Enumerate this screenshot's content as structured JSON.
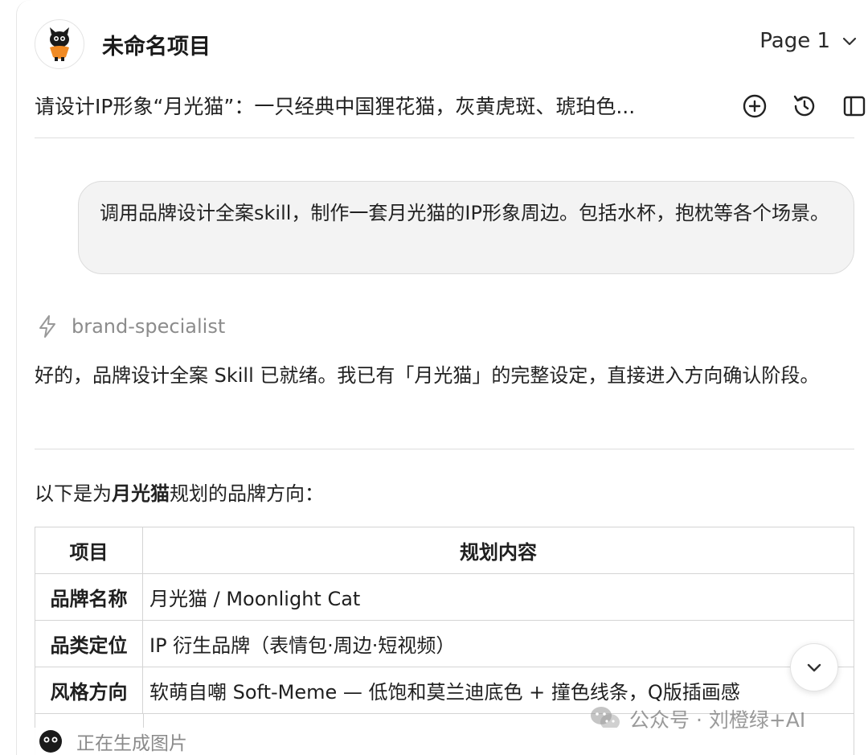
{
  "header": {
    "project_title": "未命名项目",
    "page_label": "Page 1",
    "prompt_preview": "请设计IP形象“月光猫”：一只经典中国狸花猫，灰黄虎斑、琥珀色..."
  },
  "toolbar_icons": [
    "plus-circle-icon",
    "history-icon",
    "sidebar-toggle-icon"
  ],
  "user_message": "调用品牌设计全案skill，制作一套月光猫的IP形象周边。包括水杯，抱枕等各个场景。",
  "skill_badge": {
    "name": "brand-specialist",
    "icon": "bolt-icon"
  },
  "assistant_reply": "好的，品牌设计全案 Skill 已就绪。我已有「月光猫」的完整设定，直接进入方向确认阶段。",
  "intro": {
    "prefix": "以下是为",
    "bold": "月光猫",
    "suffix": "规划的品牌方向："
  },
  "plan_table": {
    "headers": [
      "项目",
      "规划内容"
    ],
    "rows": [
      {
        "key": "品牌名称",
        "value": "月光猫 / Moonlight Cat"
      },
      {
        "key": "品类定位",
        "value": "IP 衍生品牌（表情包·周边·短视频）"
      },
      {
        "key": "风格方向",
        "value": "软萌自嘲 Soft-Meme — 低饱和莫兰迪底色 + 撞色线条，Q版插画感"
      }
    ]
  },
  "status": {
    "text": "正在生成图片"
  },
  "watermark": {
    "text": "公众号 · 刘橙绿+AI"
  },
  "colors": {
    "bubble_bg": "#f3f3f3",
    "muted_text": "#8c8c8c",
    "border": "#d4d4d4"
  }
}
